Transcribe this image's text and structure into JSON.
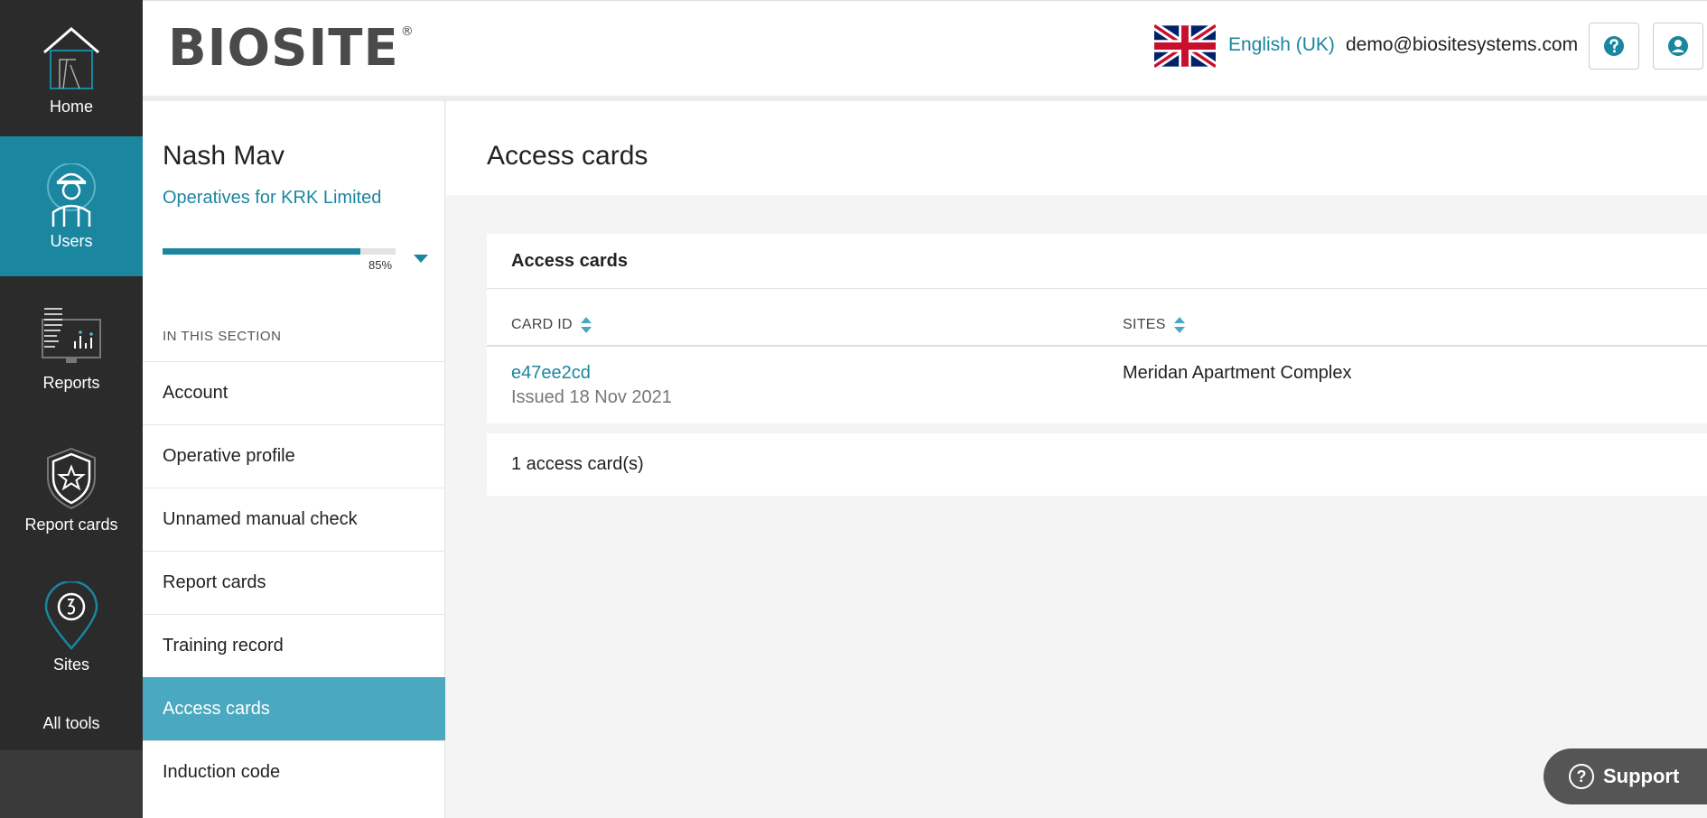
{
  "nav": {
    "home": "Home",
    "users": "Users",
    "reports": "Reports",
    "report_cards": "Report cards",
    "sites": "Sites",
    "all_tools": "All tools"
  },
  "header": {
    "logo": "BIOSITE",
    "logo_mark": "®",
    "language": "English (UK)",
    "email": "demo@biositesystems.com"
  },
  "profile": {
    "name": "Nash Mav",
    "subtitle": "Operatives for KRK Limited",
    "progress_percent": 85,
    "progress_label": "85%"
  },
  "section": {
    "heading": "IN THIS SECTION",
    "items": [
      {
        "label": "Account",
        "active": false
      },
      {
        "label": "Operative profile",
        "active": false
      },
      {
        "label": "Unnamed manual check",
        "active": false
      },
      {
        "label": "Report cards",
        "active": false
      },
      {
        "label": "Training record",
        "active": false
      },
      {
        "label": "Access cards",
        "active": true
      },
      {
        "label": "Induction code",
        "active": false
      }
    ]
  },
  "main": {
    "title": "Access cards",
    "card_title": "Access cards",
    "columns": {
      "card_id": "CARD ID",
      "sites": "SITES"
    },
    "rows": [
      {
        "card_id": "e47ee2cd",
        "issued": "Issued 18 Nov 2021",
        "site": "Meridan Apartment Complex"
      }
    ],
    "count_text": "1 access card(s)"
  },
  "support": {
    "label": "Support"
  },
  "colors": {
    "accent": "#1a86a0",
    "active_menu": "#4aa8c0",
    "nav_bg": "#2b2b2b"
  }
}
